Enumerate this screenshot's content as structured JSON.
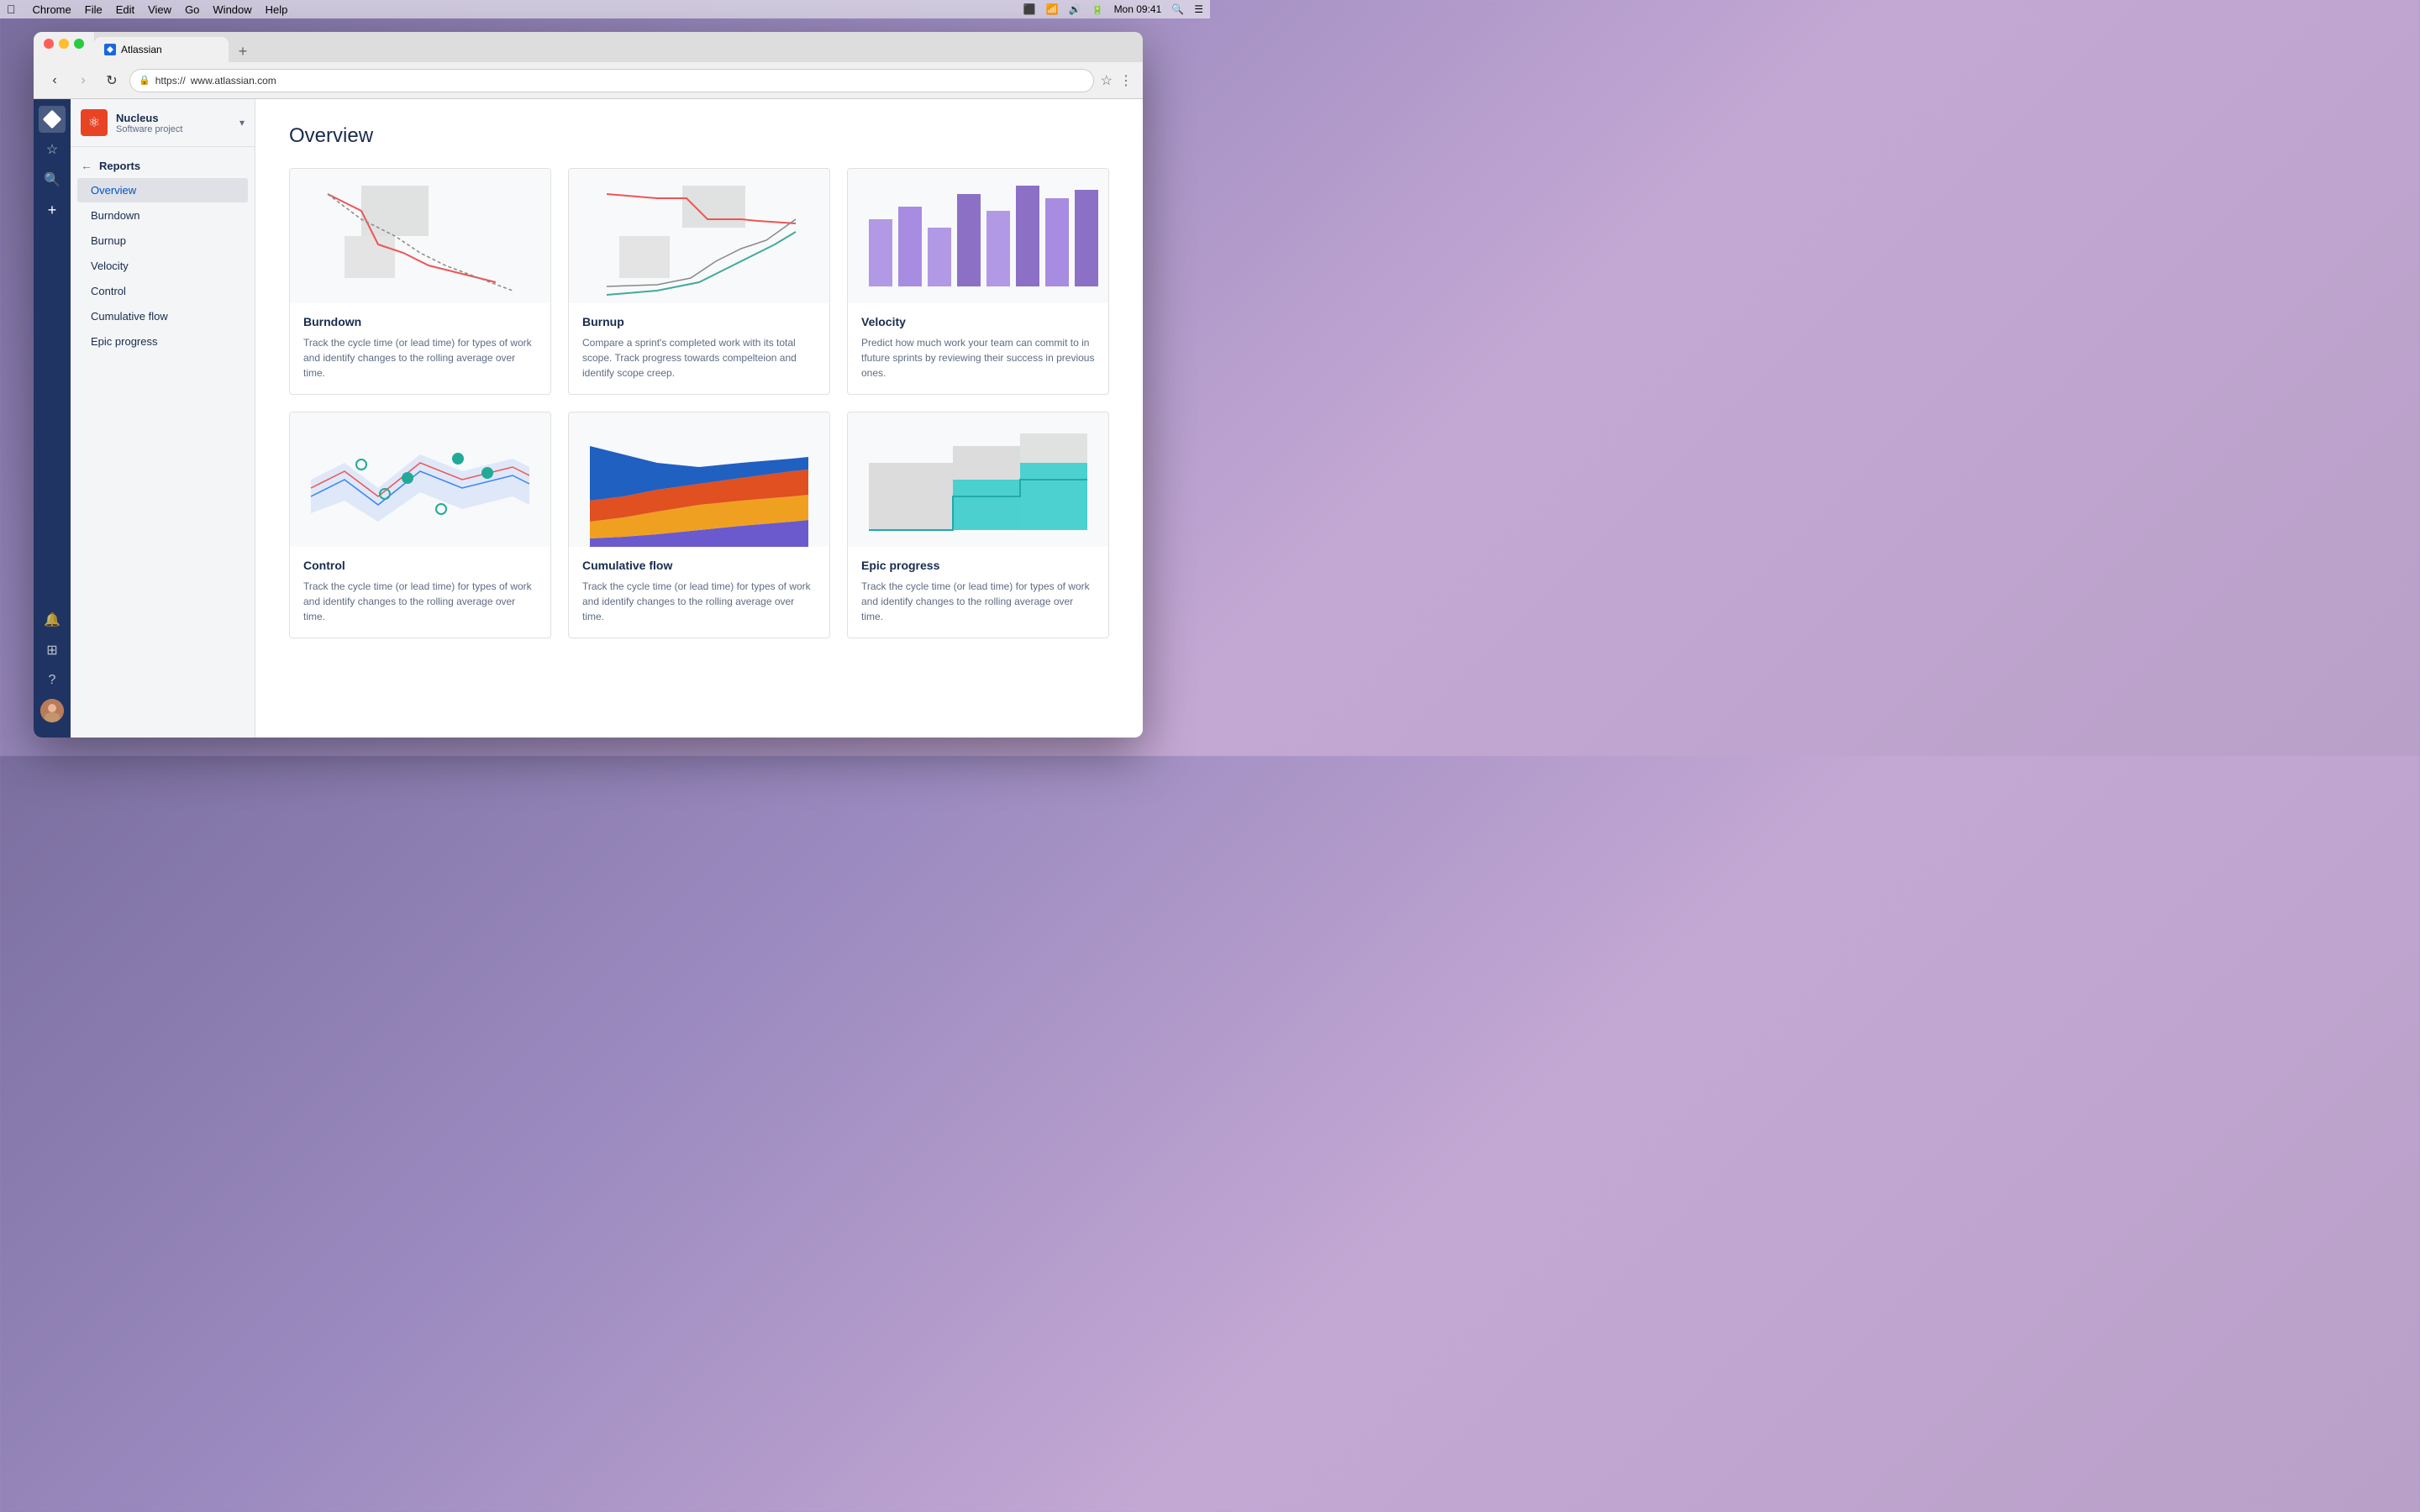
{
  "menubar": {
    "apple": "&#63743;",
    "items": [
      "Chrome",
      "File",
      "Edit",
      "View",
      "Go",
      "Window",
      "Help"
    ],
    "time": "Mon 09:41"
  },
  "browser": {
    "tab_label": "Atlassian",
    "url_prefix": "https://",
    "url": "www.atlassian.com",
    "add_tab": "+"
  },
  "sidebar_icons": {
    "diamond_label": "home",
    "star_label": "starred",
    "search_label": "search",
    "plus_label": "create",
    "bell_label": "notifications",
    "grid_label": "apps",
    "help_label": "help",
    "avatar_label": "user-avatar"
  },
  "project": {
    "name": "Nucleus",
    "type": "Software project",
    "icon": "⚛"
  },
  "nav": {
    "back_label": "Reports",
    "back_arrow": "←",
    "items": [
      {
        "id": "overview",
        "label": "Overview",
        "active": true
      },
      {
        "id": "burndown",
        "label": "Burndown",
        "active": false
      },
      {
        "id": "burnup",
        "label": "Burnup",
        "active": false
      },
      {
        "id": "velocity",
        "label": "Velocity",
        "active": false
      },
      {
        "id": "control",
        "label": "Control",
        "active": false
      },
      {
        "id": "cumulative-flow",
        "label": "Cumulative flow",
        "active": false
      },
      {
        "id": "epic-progress",
        "label": "Epic progress",
        "active": false
      }
    ]
  },
  "main": {
    "title": "Overview",
    "cards": [
      {
        "id": "burndown",
        "title": "Burndown",
        "description": "Track the cycle time (or lead time) for types of work and identify changes to the rolling average over time.",
        "chart_type": "burndown"
      },
      {
        "id": "burnup",
        "title": "Burnup",
        "description": "Compare a sprint's completed work with its total scope. Track progress towards compelteion and identify scope creep.",
        "chart_type": "burnup"
      },
      {
        "id": "velocity",
        "title": "Velocity",
        "description": "Predict how much work your team can commit to in tfuture sprints by reviewing their success in previous ones.",
        "chart_type": "velocity"
      },
      {
        "id": "control",
        "title": "Control",
        "description": "Track the cycle time (or lead time) for types of work and identify changes to the rolling average over time.",
        "chart_type": "control"
      },
      {
        "id": "cumulative-flow",
        "title": "Cumulative flow",
        "description": "Track the cycle time (or lead time) for types of work and identify changes to the rolling average over time.",
        "chart_type": "cumulative-flow"
      },
      {
        "id": "epic-progress",
        "title": "Epic progress",
        "description": "Track the cycle time (or lead time) for types of work and identify changes to the rolling average over time.",
        "chart_type": "epic-progress"
      }
    ]
  }
}
